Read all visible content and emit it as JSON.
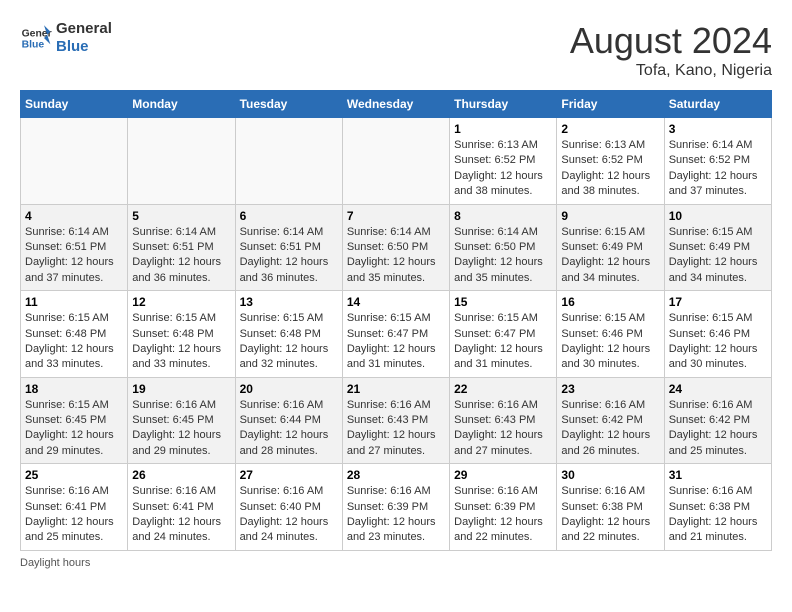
{
  "header": {
    "logo_line1": "General",
    "logo_line2": "Blue",
    "month_year": "August 2024",
    "location": "Tofa, Kano, Nigeria"
  },
  "weekdays": [
    "Sunday",
    "Monday",
    "Tuesday",
    "Wednesday",
    "Thursday",
    "Friday",
    "Saturday"
  ],
  "weeks": [
    [
      {
        "day": "",
        "info": ""
      },
      {
        "day": "",
        "info": ""
      },
      {
        "day": "",
        "info": ""
      },
      {
        "day": "",
        "info": ""
      },
      {
        "day": "1",
        "info": "Sunrise: 6:13 AM\nSunset: 6:52 PM\nDaylight: 12 hours\nand 38 minutes."
      },
      {
        "day": "2",
        "info": "Sunrise: 6:13 AM\nSunset: 6:52 PM\nDaylight: 12 hours\nand 38 minutes."
      },
      {
        "day": "3",
        "info": "Sunrise: 6:14 AM\nSunset: 6:52 PM\nDaylight: 12 hours\nand 37 minutes."
      }
    ],
    [
      {
        "day": "4",
        "info": "Sunrise: 6:14 AM\nSunset: 6:51 PM\nDaylight: 12 hours\nand 37 minutes."
      },
      {
        "day": "5",
        "info": "Sunrise: 6:14 AM\nSunset: 6:51 PM\nDaylight: 12 hours\nand 36 minutes."
      },
      {
        "day": "6",
        "info": "Sunrise: 6:14 AM\nSunset: 6:51 PM\nDaylight: 12 hours\nand 36 minutes."
      },
      {
        "day": "7",
        "info": "Sunrise: 6:14 AM\nSunset: 6:50 PM\nDaylight: 12 hours\nand 35 minutes."
      },
      {
        "day": "8",
        "info": "Sunrise: 6:14 AM\nSunset: 6:50 PM\nDaylight: 12 hours\nand 35 minutes."
      },
      {
        "day": "9",
        "info": "Sunrise: 6:15 AM\nSunset: 6:49 PM\nDaylight: 12 hours\nand 34 minutes."
      },
      {
        "day": "10",
        "info": "Sunrise: 6:15 AM\nSunset: 6:49 PM\nDaylight: 12 hours\nand 34 minutes."
      }
    ],
    [
      {
        "day": "11",
        "info": "Sunrise: 6:15 AM\nSunset: 6:48 PM\nDaylight: 12 hours\nand 33 minutes."
      },
      {
        "day": "12",
        "info": "Sunrise: 6:15 AM\nSunset: 6:48 PM\nDaylight: 12 hours\nand 33 minutes."
      },
      {
        "day": "13",
        "info": "Sunrise: 6:15 AM\nSunset: 6:48 PM\nDaylight: 12 hours\nand 32 minutes."
      },
      {
        "day": "14",
        "info": "Sunrise: 6:15 AM\nSunset: 6:47 PM\nDaylight: 12 hours\nand 31 minutes."
      },
      {
        "day": "15",
        "info": "Sunrise: 6:15 AM\nSunset: 6:47 PM\nDaylight: 12 hours\nand 31 minutes."
      },
      {
        "day": "16",
        "info": "Sunrise: 6:15 AM\nSunset: 6:46 PM\nDaylight: 12 hours\nand 30 minutes."
      },
      {
        "day": "17",
        "info": "Sunrise: 6:15 AM\nSunset: 6:46 PM\nDaylight: 12 hours\nand 30 minutes."
      }
    ],
    [
      {
        "day": "18",
        "info": "Sunrise: 6:15 AM\nSunset: 6:45 PM\nDaylight: 12 hours\nand 29 minutes."
      },
      {
        "day": "19",
        "info": "Sunrise: 6:16 AM\nSunset: 6:45 PM\nDaylight: 12 hours\nand 29 minutes."
      },
      {
        "day": "20",
        "info": "Sunrise: 6:16 AM\nSunset: 6:44 PM\nDaylight: 12 hours\nand 28 minutes."
      },
      {
        "day": "21",
        "info": "Sunrise: 6:16 AM\nSunset: 6:43 PM\nDaylight: 12 hours\nand 27 minutes."
      },
      {
        "day": "22",
        "info": "Sunrise: 6:16 AM\nSunset: 6:43 PM\nDaylight: 12 hours\nand 27 minutes."
      },
      {
        "day": "23",
        "info": "Sunrise: 6:16 AM\nSunset: 6:42 PM\nDaylight: 12 hours\nand 26 minutes."
      },
      {
        "day": "24",
        "info": "Sunrise: 6:16 AM\nSunset: 6:42 PM\nDaylight: 12 hours\nand 25 minutes."
      }
    ],
    [
      {
        "day": "25",
        "info": "Sunrise: 6:16 AM\nSunset: 6:41 PM\nDaylight: 12 hours\nand 25 minutes."
      },
      {
        "day": "26",
        "info": "Sunrise: 6:16 AM\nSunset: 6:41 PM\nDaylight: 12 hours\nand 24 minutes."
      },
      {
        "day": "27",
        "info": "Sunrise: 6:16 AM\nSunset: 6:40 PM\nDaylight: 12 hours\nand 24 minutes."
      },
      {
        "day": "28",
        "info": "Sunrise: 6:16 AM\nSunset: 6:39 PM\nDaylight: 12 hours\nand 23 minutes."
      },
      {
        "day": "29",
        "info": "Sunrise: 6:16 AM\nSunset: 6:39 PM\nDaylight: 12 hours\nand 22 minutes."
      },
      {
        "day": "30",
        "info": "Sunrise: 6:16 AM\nSunset: 6:38 PM\nDaylight: 12 hours\nand 22 minutes."
      },
      {
        "day": "31",
        "info": "Sunrise: 6:16 AM\nSunset: 6:38 PM\nDaylight: 12 hours\nand 21 minutes."
      }
    ]
  ],
  "footer": {
    "daylight_label": "Daylight hours"
  }
}
